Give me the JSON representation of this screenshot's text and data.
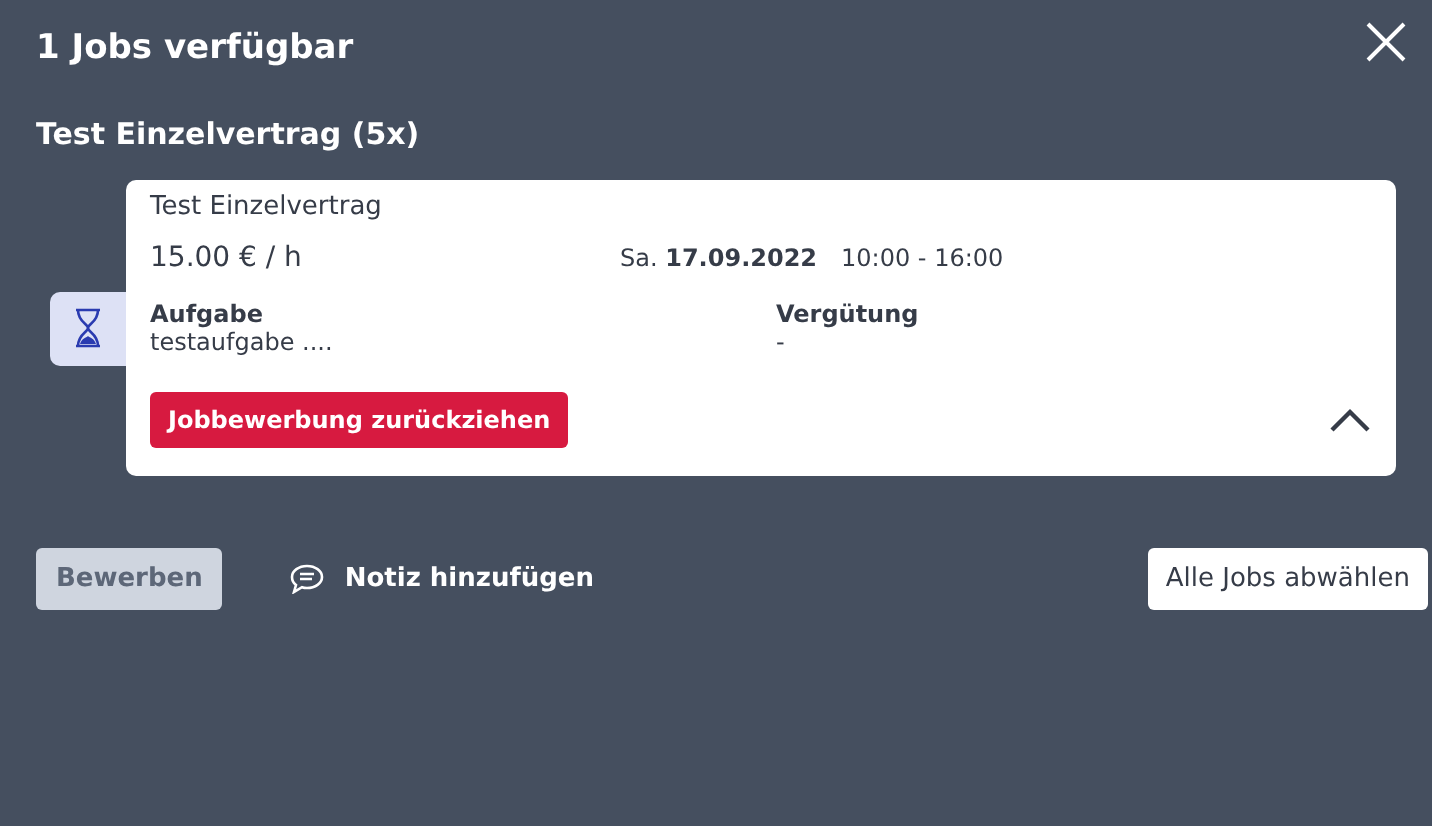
{
  "title": "1 Jobs verfügbar",
  "group_title": "Test Einzelvertrag (5x)",
  "jobs": [
    {
      "title": "Test Einzelvertrag",
      "rate": "15.00 € / h",
      "date": "Sa. **17.09.2022**",
      "time": "10:00 - 16:00",
      "expanded": true,
      "fields": [
        {
          "label": "Aufgabe",
          "value": "testaufgabe ...."
        },
        {
          "label": "Vergütung",
          "value": "-"
        }
      ],
      "withdraw_button": "Jobbewerbung zurückziehen"
    }
  ],
  "apply_button": {
    "label": "Bewerben",
    "disabled": true
  },
  "note_button": "Notiz hinzufügen",
  "deselect_button": "Alle Jobs abwählen"
}
